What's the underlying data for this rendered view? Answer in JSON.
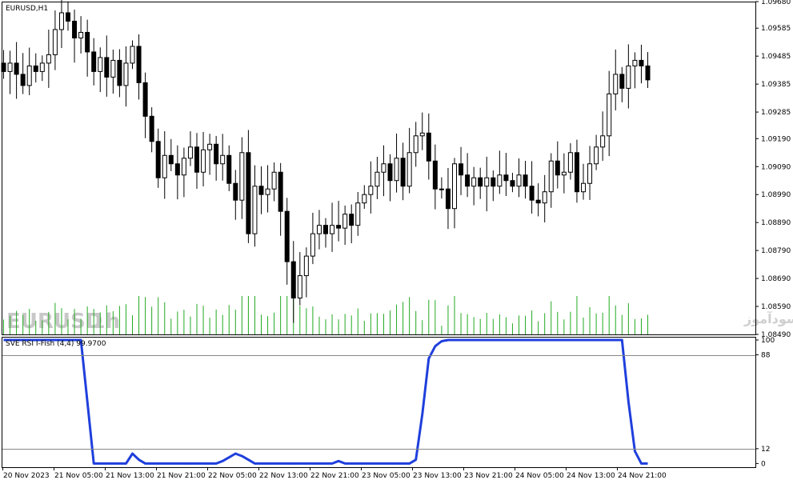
{
  "window": {
    "symbol_label": "EURUSD,H1",
    "watermark_symbol": "EURUSD",
    "watermark_timeframe": "1h",
    "watermark_site": "انتشار در سایت سودآموز"
  },
  "colors": {
    "background": "#ffffff",
    "frame": "#000000",
    "candle_body_up": "#ffffff",
    "candle_body_down": "#000000",
    "volume": "#22aa22",
    "indicator_line": "#1f3fdc",
    "level_line": "#888888"
  },
  "chart_data": [
    {
      "type": "candlestick",
      "title": "EURUSD,H1",
      "ylim": [
        1.0849,
        1.0968
      ],
      "y_ticks": [
        "1.09680",
        "1.09585",
        "1.09485",
        "1.09385",
        "1.09285",
        "1.09190",
        "1.09090",
        "1.08990",
        "1.08890",
        "1.08790",
        "1.08690",
        "1.08590",
        "1.08490"
      ],
      "x_ticks": [
        "20 Nov 2023",
        "21 Nov 05:00",
        "21 Nov 13:00",
        "21 Nov 21:00",
        "22 Nov 05:00",
        "22 Nov 13:00",
        "22 Nov 21:00",
        "23 Nov 05:00",
        "23 Nov 13:00",
        "23 Nov 21:00",
        "24 Nov 05:00",
        "24 Nov 13:00",
        "24 Nov 21:00"
      ],
      "closes": [
        1.0943,
        1.0946,
        1.0942,
        1.0938,
        1.0945,
        1.0943,
        1.0946,
        1.0949,
        1.0958,
        1.0964,
        1.0961,
        1.0955,
        1.0957,
        1.095,
        1.0943,
        1.0948,
        1.0941,
        1.0947,
        1.0938,
        1.0946,
        1.0952,
        1.0939,
        1.0927,
        1.0918,
        1.0905,
        1.0913,
        1.091,
        1.0906,
        1.0912,
        1.0916,
        1.0907,
        1.0915,
        1.0917,
        1.091,
        1.0913,
        1.0903,
        1.0897,
        1.0914,
        1.0885,
        1.0902,
        1.0899,
        1.0901,
        1.0907,
        1.0893,
        1.0875,
        1.0862,
        1.087,
        1.0877,
        1.0885,
        1.0888,
        1.0885,
        1.0888,
        1.0887,
        1.0892,
        1.0888,
        1.0896,
        1.0899,
        1.0902,
        1.0907,
        1.091,
        1.0904,
        1.0912,
        1.0902,
        1.0914,
        1.092,
        1.0921,
        1.0911,
        1.0901,
        1.0901,
        1.0894,
        1.091,
        1.0906,
        1.0902,
        1.0905,
        1.0902,
        1.0905,
        1.0902,
        1.0906,
        1.0904,
        1.0902,
        1.0906,
        1.0902,
        1.0897,
        1.0896,
        1.09,
        1.0911,
        1.0906,
        1.0907,
        1.0914,
        1.09,
        1.0903,
        1.091,
        1.0916,
        1.092,
        1.0935,
        1.0942,
        1.0937,
        1.0945,
        1.0947,
        1.0945,
        1.094
      ]
    },
    {
      "type": "line",
      "title": "SVE RSI I-Fish (4,4) 99.9700",
      "ylim": [
        -3,
        100
      ],
      "y_ticks": [
        "100",
        "88",
        "12",
        "0"
      ],
      "levels": [
        88,
        12
      ],
      "values": [
        100,
        100,
        100,
        100,
        100,
        100,
        100,
        100,
        100,
        100,
        100,
        100,
        100,
        50,
        0,
        0,
        0,
        0,
        0,
        0,
        8,
        3,
        0,
        0,
        0,
        0,
        0,
        0,
        0,
        0,
        0,
        0,
        0,
        0,
        2,
        5,
        8,
        6,
        3,
        0,
        0,
        0,
        0,
        0,
        0,
        0,
        0,
        0,
        0,
        0,
        0,
        0,
        2,
        0,
        0,
        0,
        0,
        0,
        0,
        0,
        0,
        0,
        0,
        0,
        3,
        40,
        85,
        95,
        99,
        100,
        100,
        100,
        100,
        100,
        100,
        100,
        100,
        100,
        100,
        100,
        100,
        100,
        100,
        100,
        100,
        100,
        100,
        100,
        100,
        100,
        100,
        100,
        100,
        100,
        100,
        100,
        100,
        50,
        10,
        0,
        0
      ]
    }
  ]
}
